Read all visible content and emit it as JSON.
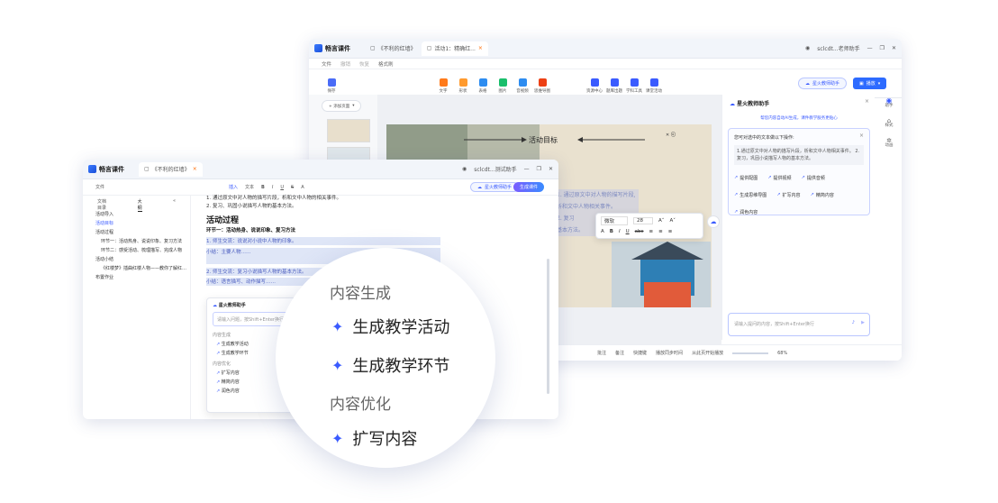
{
  "back_window": {
    "logo": "畅言课件",
    "tabs": [
      "《不利的红墙》",
      "活动1：精确红..."
    ],
    "user": "sclcdt...老师助手",
    "menu": [
      "文件",
      "撤销",
      "恢复",
      "格式刷"
    ],
    "ribbon": [
      "保存",
      "文字",
      "形状",
      "表格",
      "图片",
      "音视频",
      "思维导图",
      "资源中心",
      "题库出题",
      "学科工具",
      "课堂活动"
    ],
    "assistant_btn": "星火教师助手",
    "present_btn": "播放",
    "add_page": "+ 添加页面",
    "slide_title": "活动目标",
    "slide_lines": [
      "1. 通过原文中对人物的描写片段,",
      "析和文中人物相关事件。",
      "2. 复习",
      "基本方法。"
    ],
    "format": {
      "font": "微软",
      "size": "28"
    },
    "side_panel": {
      "title": "星火教师助手",
      "subtitle": "帮您内容自动AI生成，课件教学服务更贴心",
      "card_title": "您可对选中的文本做以下操作:",
      "card_text": "1.通过原文中对人物的描写片段，析和文中人物相关事件。 2.复习，巩固小说描写人物的基本方法。",
      "chips": [
        "提供配图",
        "提供视频",
        "提供音频",
        "生成思维导图",
        "扩写内容",
        "精简内容",
        "润色内容"
      ],
      "input_placeholder": "请输入提问的内容，按Shift+Enter换行"
    },
    "right_rail": [
      "助手",
      "样式",
      "动画"
    ],
    "status": [
      "批注",
      "备注",
      "快捷键",
      "播放同步时间",
      "从此页开始播放",
      "68%"
    ]
  },
  "front_window": {
    "logo": "畅言课件",
    "tab": "《不利的红墙》",
    "user": "sclcdt...测试助手",
    "menu": [
      "文件"
    ],
    "toolbar": [
      "插入",
      "文本",
      "B",
      "I",
      "U",
      "S",
      "A"
    ],
    "assistant_btn": "星火教师助手",
    "share_btn": "生成课件",
    "outline_tabs": [
      "文档目录",
      "大纲"
    ],
    "outline": [
      "活动导入",
      "活动目标",
      "活动过程",
      "环节一：活动热身、说说印象、复习方法",
      "环节二：感受活动、梳理描写、完成人物",
      "活动小结",
      "《红楼梦》插曲红楼人物——教你了解红…",
      "布置作业"
    ],
    "doc_lines": [
      "1. 通过原文中对人物的描写片段，析和文中人物的相关事件。",
      "2. 复习、巩固小说描写人物的基本方法。"
    ],
    "doc_h2": "活动过程",
    "doc_h3": "环节一：活动热身、说说印象、复习方法",
    "doc_items": [
      "1. 师生交流：说说对小说中人物的印象。",
      "小结：主要人物……",
      "2. 师生交流：复习小说描写人物的基本方法。",
      "小结：语言描写、动作描写……"
    ],
    "popup": {
      "title": "星火教师助手",
      "placeholder": "请输入问题，按Shift+Enter换行",
      "section1": "内容生成",
      "items1": [
        "生成教学活动",
        "生成教学环节"
      ],
      "section2": "内容优化",
      "items2": [
        "扩写内容",
        "精简内容",
        "润色内容"
      ]
    }
  },
  "bubble": {
    "section1": "内容生成",
    "items1": [
      "生成教学活动",
      "生成教学环节"
    ],
    "section2": "内容优化",
    "items2": [
      "扩写内容"
    ]
  },
  "colors": {
    "accent": "#3a5bff",
    "brand": "#1a4fd8",
    "ribbon_orange": "#ff7a1a",
    "highlight": "#dfe6f7"
  }
}
